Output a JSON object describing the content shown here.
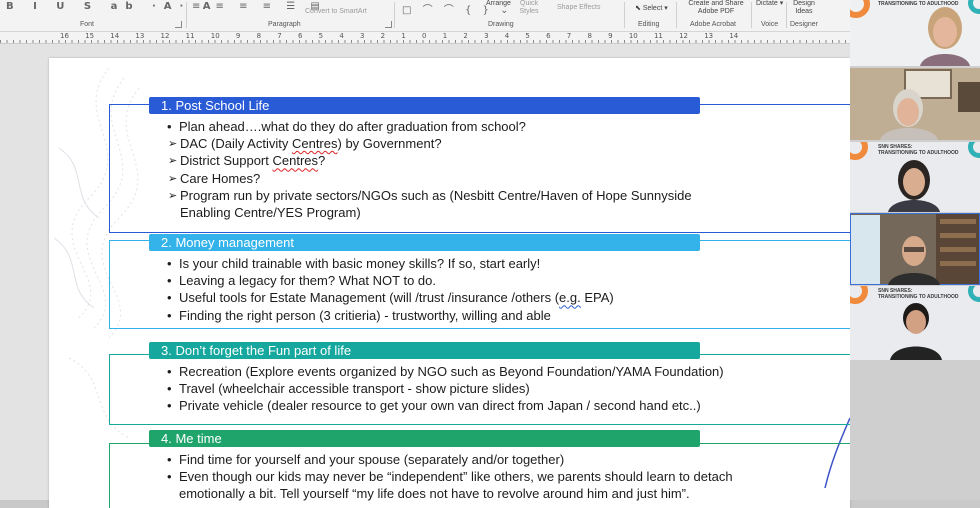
{
  "ribbon": {
    "group_labels": {
      "font": "Font",
      "paragraph": "Paragraph",
      "drawing": "Drawing",
      "editing": "Editing",
      "adobe": "Adobe Acrobat",
      "voice": "Voice",
      "designer": "Designer"
    },
    "buttons": {
      "convert_smartart": "Convert to SmartArt",
      "arrange": "Arrange",
      "quick_styles": "Quick Styles",
      "shape_effects": "Shape Effects",
      "select": "Select",
      "create_share_pdf": "Create and Share Adobe PDF",
      "dictate": "Dictate",
      "design_ideas": "Design Ideas"
    }
  },
  "ruler": {
    "numbers": "16 15 14 13 12 11 10 9 8 7 6 5 4 3 2 1 0 1 2 3 4 5 6 7 8 9 10 11 12 13 14"
  },
  "slide": {
    "sections": [
      {
        "title": "1. Post School Life",
        "items": [
          {
            "kind": "bullet",
            "text": "Plan ahead….what do they do after graduation from school?"
          },
          {
            "kind": "arrow",
            "pre": "DAC (Daily Activity ",
            "mark": "Centres",
            "post": ") by Government?"
          },
          {
            "kind": "arrow",
            "pre": "District Support ",
            "mark": "Centres",
            "post": "?"
          },
          {
            "kind": "arrow",
            "text": "Care Homes?"
          },
          {
            "kind": "arrow",
            "text": "Program run by private sectors/NGOs such as (Nesbitt Centre/Haven of Hope Sunnyside",
            "cont": "Enabling Centre/YES Program)"
          }
        ]
      },
      {
        "title": "2. Money management",
        "items": [
          {
            "kind": "bullet",
            "text": "Is your child trainable with basic money skills?  If so, start early!"
          },
          {
            "kind": "bullet",
            "text": "Leaving a legacy for them?  What NOT to do."
          },
          {
            "kind": "bullet",
            "pre": "Useful tools for Estate Management (will /trust /insurance /others (",
            "mark": "e.g.",
            "post": " EPA)"
          },
          {
            "kind": "bullet",
            "text": "Finding the right person (3 critieria) - trustworthy, willing and able"
          }
        ]
      },
      {
        "title": "3. Don’t forget the Fun part of life",
        "items": [
          {
            "kind": "bullet",
            "text": "Recreation (Explore events organized by NGO such as Beyond Foundation/YAMA Foundation)"
          },
          {
            "kind": "bullet",
            "text": "Travel (wheelchair accessible transport - show picture slides)"
          },
          {
            "kind": "bullet",
            "text": "Private vehicle (dealer resource to get your own van direct from Japan / second hand etc..)"
          }
        ]
      },
      {
        "title": "4. Me time",
        "items": [
          {
            "kind": "bullet",
            "text": "Find time for yourself and your spouse (separately and/or together)"
          },
          {
            "kind": "bullet",
            "text": "Even though our kids may never be “independent” like others, we parents should learn to detach",
            "cont": "emotionally a bit.  Tell yourself “my life does not have to revolve around him and just him”."
          }
        ]
      }
    ]
  },
  "video_panel": {
    "caption_line1": "SNN SHARES:",
    "caption_line2": "TRANSITIONING TO ADULTHOOD"
  },
  "colors": {
    "section1": "#2a5bd7",
    "section2": "#33b3ea",
    "section3": "#16a89e",
    "section4": "#1fa46c"
  }
}
